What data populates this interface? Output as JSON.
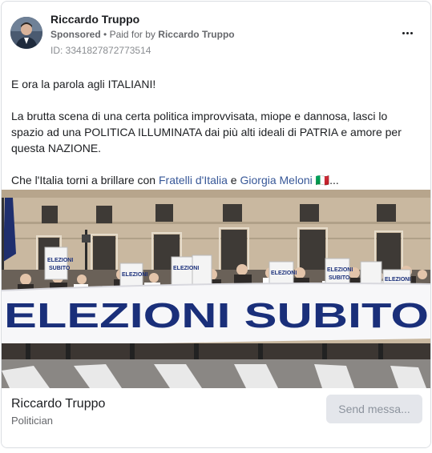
{
  "advertiser": {
    "name": "Riccardo Truppo",
    "sponsored_label": "Sponsored",
    "separator": "•",
    "paid_for_prefix": "Paid for by",
    "paid_for_name": "Riccardo Truppo",
    "ad_id": "ID: 3341827872773514"
  },
  "post": {
    "line1": "E ora la parola agli ITALIANI!",
    "line2": "La brutta scena di una certa politica improvvisata, miope e dannosa, lasci lo spazio ad una POLITICA ILLUMINATA dai più alti ideali di PATRIA e amore per questa NAZIONE.",
    "line3_prefix": "Che l'Italia torni a brillare con ",
    "line3_link1": "Fratelli d'Italia",
    "line3_mid": " e ",
    "line3_link2": "Giorgia Meloni",
    "line3_suffix": " 🇮🇹..."
  },
  "photo": {
    "banner_text": "ELEZIONI SUBITO",
    "sign_text": "ELEZIONI SUBITO"
  },
  "footer": {
    "page_name": "Riccardo Truppo",
    "page_category": "Politician",
    "cta_label": "Send messa..."
  },
  "colors": {
    "link": "#385898",
    "banner_text": "#1a2f7a",
    "button_bg": "#e4e6eb",
    "muted": "#65676b"
  }
}
